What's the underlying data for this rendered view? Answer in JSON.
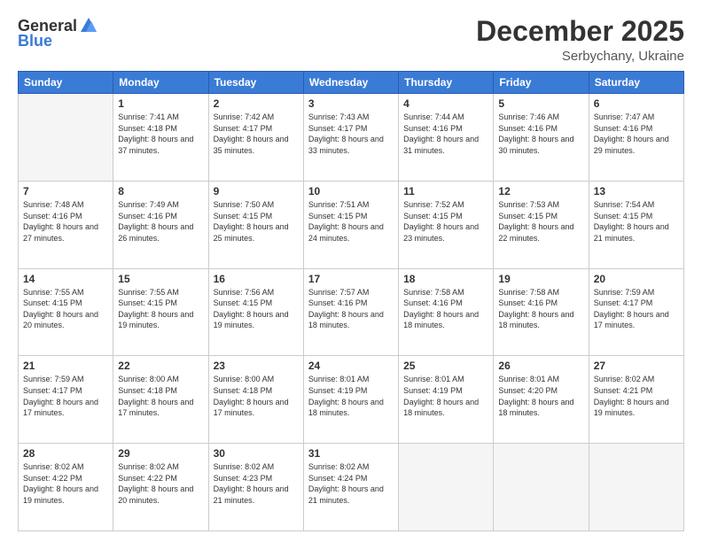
{
  "header": {
    "logo_general": "General",
    "logo_blue": "Blue",
    "month_title": "December 2025",
    "location": "Serbychany, Ukraine"
  },
  "weekdays": [
    "Sunday",
    "Monday",
    "Tuesday",
    "Wednesday",
    "Thursday",
    "Friday",
    "Saturday"
  ],
  "weeks": [
    [
      {
        "day": "",
        "sunrise": "",
        "sunset": "",
        "daylight": ""
      },
      {
        "day": "1",
        "sunrise": "Sunrise: 7:41 AM",
        "sunset": "Sunset: 4:18 PM",
        "daylight": "Daylight: 8 hours and 37 minutes."
      },
      {
        "day": "2",
        "sunrise": "Sunrise: 7:42 AM",
        "sunset": "Sunset: 4:17 PM",
        "daylight": "Daylight: 8 hours and 35 minutes."
      },
      {
        "day": "3",
        "sunrise": "Sunrise: 7:43 AM",
        "sunset": "Sunset: 4:17 PM",
        "daylight": "Daylight: 8 hours and 33 minutes."
      },
      {
        "day": "4",
        "sunrise": "Sunrise: 7:44 AM",
        "sunset": "Sunset: 4:16 PM",
        "daylight": "Daylight: 8 hours and 31 minutes."
      },
      {
        "day": "5",
        "sunrise": "Sunrise: 7:46 AM",
        "sunset": "Sunset: 4:16 PM",
        "daylight": "Daylight: 8 hours and 30 minutes."
      },
      {
        "day": "6",
        "sunrise": "Sunrise: 7:47 AM",
        "sunset": "Sunset: 4:16 PM",
        "daylight": "Daylight: 8 hours and 29 minutes."
      }
    ],
    [
      {
        "day": "7",
        "sunrise": "Sunrise: 7:48 AM",
        "sunset": "Sunset: 4:16 PM",
        "daylight": "Daylight: 8 hours and 27 minutes."
      },
      {
        "day": "8",
        "sunrise": "Sunrise: 7:49 AM",
        "sunset": "Sunset: 4:16 PM",
        "daylight": "Daylight: 8 hours and 26 minutes."
      },
      {
        "day": "9",
        "sunrise": "Sunrise: 7:50 AM",
        "sunset": "Sunset: 4:15 PM",
        "daylight": "Daylight: 8 hours and 25 minutes."
      },
      {
        "day": "10",
        "sunrise": "Sunrise: 7:51 AM",
        "sunset": "Sunset: 4:15 PM",
        "daylight": "Daylight: 8 hours and 24 minutes."
      },
      {
        "day": "11",
        "sunrise": "Sunrise: 7:52 AM",
        "sunset": "Sunset: 4:15 PM",
        "daylight": "Daylight: 8 hours and 23 minutes."
      },
      {
        "day": "12",
        "sunrise": "Sunrise: 7:53 AM",
        "sunset": "Sunset: 4:15 PM",
        "daylight": "Daylight: 8 hours and 22 minutes."
      },
      {
        "day": "13",
        "sunrise": "Sunrise: 7:54 AM",
        "sunset": "Sunset: 4:15 PM",
        "daylight": "Daylight: 8 hours and 21 minutes."
      }
    ],
    [
      {
        "day": "14",
        "sunrise": "Sunrise: 7:55 AM",
        "sunset": "Sunset: 4:15 PM",
        "daylight": "Daylight: 8 hours and 20 minutes."
      },
      {
        "day": "15",
        "sunrise": "Sunrise: 7:55 AM",
        "sunset": "Sunset: 4:15 PM",
        "daylight": "Daylight: 8 hours and 19 minutes."
      },
      {
        "day": "16",
        "sunrise": "Sunrise: 7:56 AM",
        "sunset": "Sunset: 4:15 PM",
        "daylight": "Daylight: 8 hours and 19 minutes."
      },
      {
        "day": "17",
        "sunrise": "Sunrise: 7:57 AM",
        "sunset": "Sunset: 4:16 PM",
        "daylight": "Daylight: 8 hours and 18 minutes."
      },
      {
        "day": "18",
        "sunrise": "Sunrise: 7:58 AM",
        "sunset": "Sunset: 4:16 PM",
        "daylight": "Daylight: 8 hours and 18 minutes."
      },
      {
        "day": "19",
        "sunrise": "Sunrise: 7:58 AM",
        "sunset": "Sunset: 4:16 PM",
        "daylight": "Daylight: 8 hours and 18 minutes."
      },
      {
        "day": "20",
        "sunrise": "Sunrise: 7:59 AM",
        "sunset": "Sunset: 4:17 PM",
        "daylight": "Daylight: 8 hours and 17 minutes."
      }
    ],
    [
      {
        "day": "21",
        "sunrise": "Sunrise: 7:59 AM",
        "sunset": "Sunset: 4:17 PM",
        "daylight": "Daylight: 8 hours and 17 minutes."
      },
      {
        "day": "22",
        "sunrise": "Sunrise: 8:00 AM",
        "sunset": "Sunset: 4:18 PM",
        "daylight": "Daylight: 8 hours and 17 minutes."
      },
      {
        "day": "23",
        "sunrise": "Sunrise: 8:00 AM",
        "sunset": "Sunset: 4:18 PM",
        "daylight": "Daylight: 8 hours and 17 minutes."
      },
      {
        "day": "24",
        "sunrise": "Sunrise: 8:01 AM",
        "sunset": "Sunset: 4:19 PM",
        "daylight": "Daylight: 8 hours and 18 minutes."
      },
      {
        "day": "25",
        "sunrise": "Sunrise: 8:01 AM",
        "sunset": "Sunset: 4:19 PM",
        "daylight": "Daylight: 8 hours and 18 minutes."
      },
      {
        "day": "26",
        "sunrise": "Sunrise: 8:01 AM",
        "sunset": "Sunset: 4:20 PM",
        "daylight": "Daylight: 8 hours and 18 minutes."
      },
      {
        "day": "27",
        "sunrise": "Sunrise: 8:02 AM",
        "sunset": "Sunset: 4:21 PM",
        "daylight": "Daylight: 8 hours and 19 minutes."
      }
    ],
    [
      {
        "day": "28",
        "sunrise": "Sunrise: 8:02 AM",
        "sunset": "Sunset: 4:22 PM",
        "daylight": "Daylight: 8 hours and 19 minutes."
      },
      {
        "day": "29",
        "sunrise": "Sunrise: 8:02 AM",
        "sunset": "Sunset: 4:22 PM",
        "daylight": "Daylight: 8 hours and 20 minutes."
      },
      {
        "day": "30",
        "sunrise": "Sunrise: 8:02 AM",
        "sunset": "Sunset: 4:23 PM",
        "daylight": "Daylight: 8 hours and 21 minutes."
      },
      {
        "day": "31",
        "sunrise": "Sunrise: 8:02 AM",
        "sunset": "Sunset: 4:24 PM",
        "daylight": "Daylight: 8 hours and 21 minutes."
      },
      {
        "day": "",
        "sunrise": "",
        "sunset": "",
        "daylight": ""
      },
      {
        "day": "",
        "sunrise": "",
        "sunset": "",
        "daylight": ""
      },
      {
        "day": "",
        "sunrise": "",
        "sunset": "",
        "daylight": ""
      }
    ]
  ]
}
